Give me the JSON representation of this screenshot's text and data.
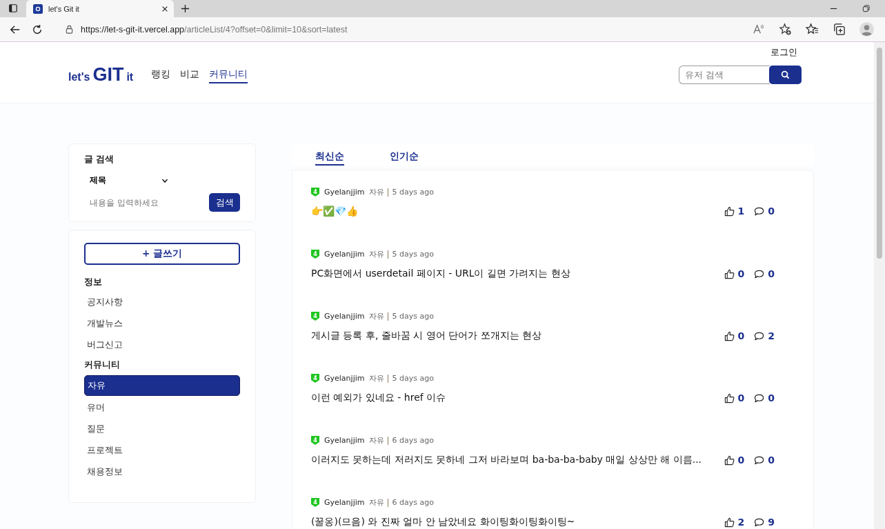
{
  "browser": {
    "tab_title": "let's Git it",
    "url_host": "https://let-s-git-it.vercel.app",
    "url_path": "/articleList/4?offset=0&limit=10&sort=latest"
  },
  "header": {
    "login": "로그인",
    "logo": {
      "pre": "let's",
      "main": "GIT",
      "post": "it"
    },
    "nav": [
      {
        "label": "랭킹",
        "selected": false
      },
      {
        "label": "비교",
        "selected": false
      },
      {
        "label": "커뮤니티",
        "selected": true
      }
    ],
    "user_search": {
      "placeholder": "유저 검색"
    }
  },
  "post_search": {
    "title": "글 검색",
    "select": "제목",
    "placeholder": "내용을 입력하세요",
    "button": "검색"
  },
  "menu": {
    "write_button": "+ 글쓰기",
    "sections": [
      {
        "title": "정보",
        "items": [
          {
            "label": "공지사항",
            "selected": false
          },
          {
            "label": "개발뉴스",
            "selected": false
          },
          {
            "label": "버그신고",
            "selected": false
          }
        ]
      },
      {
        "title": "커뮤니티",
        "items": [
          {
            "label": "자유",
            "selected": true
          },
          {
            "label": "유머",
            "selected": false
          },
          {
            "label": "질문",
            "selected": false
          },
          {
            "label": "프로젝트",
            "selected": false
          },
          {
            "label": "채용정보",
            "selected": false
          }
        ]
      }
    ]
  },
  "sort_tabs": [
    {
      "label": "최신순",
      "selected": true
    },
    {
      "label": "인기순",
      "selected": false
    }
  ],
  "posts": [
    {
      "level": "4",
      "author": "Gyelanjjim",
      "category": "자유",
      "time": "5 days ago",
      "title": "👉✅💎👍",
      "likes": "1",
      "comments": "0"
    },
    {
      "level": "4",
      "author": "Gyelanjjim",
      "category": "자유",
      "time": "5 days ago",
      "title": "PC화면에서 userdetail 페이지 - URL이 길면 가려지는 현상",
      "likes": "0",
      "comments": "0"
    },
    {
      "level": "4",
      "author": "Gyelanjjim",
      "category": "자유",
      "time": "5 days ago",
      "title": "게시글 등록 후, 줄바꿈 시 영어 단어가 쪼개지는 현상",
      "likes": "0",
      "comments": "2"
    },
    {
      "level": "4",
      "author": "Gyelanjjim",
      "category": "자유",
      "time": "5 days ago",
      "title": "이런 예외가 있네요 - href 이슈",
      "likes": "0",
      "comments": "0"
    },
    {
      "level": "4",
      "author": "Gyelanjjim",
      "category": "자유",
      "time": "6 days ago",
      "title": "이러지도 못하는데 저러지도 못하네 그저 바라보며 ba-ba-ba-baby 매일 상상만 해 이름...",
      "likes": "0",
      "comments": "0"
    },
    {
      "level": "4",
      "author": "Gyelanjjim",
      "category": "자유",
      "time": "6 days ago",
      "title": "(꿀옹)(므음) 와 진짜 얼마 안 남았네요 화이팅화이팅화이팅~",
      "likes": "2",
      "comments": "9"
    }
  ]
}
